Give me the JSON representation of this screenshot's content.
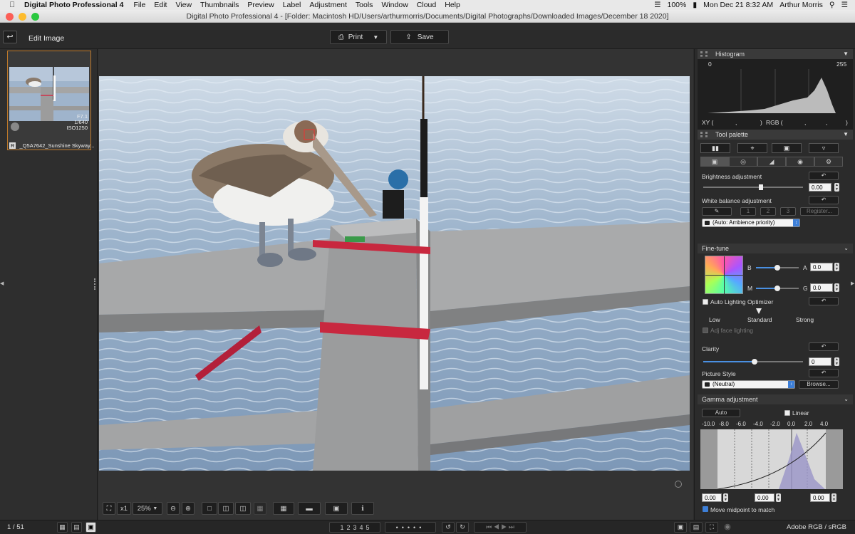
{
  "menubar": {
    "app_name": "Digital Photo Professional 4",
    "items": [
      "File",
      "Edit",
      "View",
      "Thumbnails",
      "Preview",
      "Label",
      "Adjustment",
      "Tools",
      "Window",
      "Cloud",
      "Help"
    ],
    "battery": "100%",
    "clock": "Mon Dec 21  8:32 AM",
    "user": "Arthur Morris"
  },
  "window": {
    "title": "Digital Photo Professional 4 - [Folder: Macintosh HD/Users/arthurmorris/Documents/Digital Photographs/Downloaded Images/December 18 2020]"
  },
  "toolbar": {
    "mode_label": "Edit Image",
    "print_label": "Print",
    "save_label": "Save"
  },
  "thumbnail": {
    "exposure_f": "F7.1",
    "exposure_shutter": "1/640",
    "exposure_iso": "ISO1250",
    "badge": "R",
    "filename": "_Q5A7642_Sunshine Skyway..."
  },
  "viewer": {
    "zoom_x1": "x1",
    "zoom_level": "25%"
  },
  "histogram": {
    "title": "Histogram",
    "min": "0",
    "max": "255",
    "xy_label": "XY (",
    "xy_sep": ",",
    "xy_close": ")",
    "rgb_label": "RGB (",
    "rgb_sep1": ",",
    "rgb_sep2": ",",
    "rgb_close": ")"
  },
  "tool_palette": {
    "title": "Tool palette",
    "brightness_label": "Brightness adjustment",
    "brightness_value": "0.00",
    "wb_label": "White balance adjustment",
    "wb_slot1": "1",
    "wb_slot2": "2",
    "wb_slot3": "3",
    "wb_register": "Register...",
    "wb_mode": "(Auto: Ambience priority)"
  },
  "fine_tune": {
    "title": "Fine-tune",
    "b_label": "B",
    "a_label": "A",
    "a_value": "0.0",
    "m_label": "M",
    "g_label": "G",
    "g_value": "0.0",
    "alo_label": "Auto Lighting Optimizer",
    "alo_low": "Low",
    "alo_standard": "Standard",
    "alo_strong": "Strong",
    "face_label": "Adj face lighting",
    "clarity_label": "Clarity",
    "clarity_value": "0",
    "ps_label": "Picture Style",
    "ps_value": "(Neutral)",
    "browse_label": "Browse..."
  },
  "gamma": {
    "title": "Gamma adjustment",
    "auto_label": "Auto",
    "linear_label": "Linear",
    "ticks": [
      "-10.0",
      "-8.0",
      "-6.0",
      "-4.0",
      "-2.0",
      "0.0",
      "2.0",
      "4.0"
    ],
    "val_left": "0.00",
    "val_mid": "0.00",
    "val_right": "0.00",
    "midpoint_label": "Move midpoint to match"
  },
  "status": {
    "page": "1 / 51",
    "ratings": [
      "1",
      "2",
      "3",
      "4",
      "5"
    ],
    "color_space": "Adobe RGB / sRGB"
  },
  "colors": {
    "accent": "#3d7fd8",
    "thumb_border": "#c07a2a"
  }
}
